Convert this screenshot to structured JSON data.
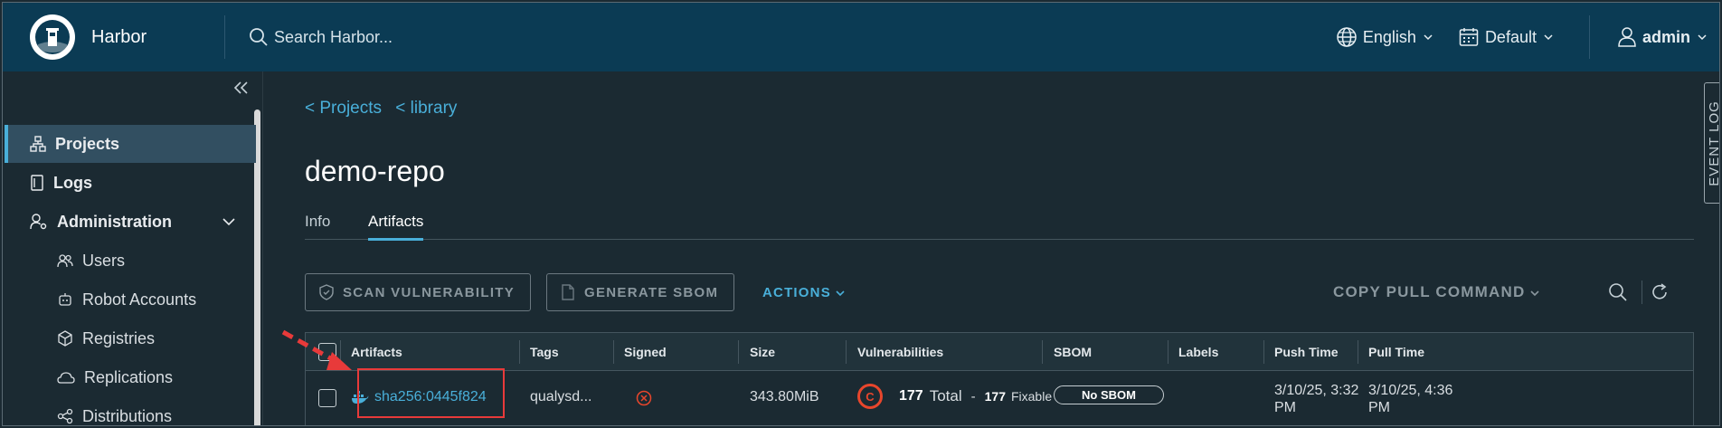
{
  "header": {
    "brand": "Harbor",
    "search_placeholder": "Search Harbor...",
    "language": "English",
    "theme": "Default",
    "user": "admin"
  },
  "sidebar": {
    "items": [
      {
        "label": "Projects",
        "icon": "projects-icon",
        "active": true
      },
      {
        "label": "Logs",
        "icon": "logs-icon"
      },
      {
        "label": "Administration",
        "icon": "administration-icon",
        "expandable": true
      },
      {
        "label": "Users",
        "icon": "users-icon"
      },
      {
        "label": "Robot Accounts",
        "icon": "robot-icon"
      },
      {
        "label": "Registries",
        "icon": "registries-icon"
      },
      {
        "label": "Replications",
        "icon": "replications-icon"
      },
      {
        "label": "Distributions",
        "icon": "distributions-icon"
      }
    ]
  },
  "breadcrumb": {
    "projects": "< Projects",
    "library": "< library"
  },
  "page": {
    "title": "demo-repo"
  },
  "tabs": [
    {
      "label": "Info",
      "active": false
    },
    {
      "label": "Artifacts",
      "active": true
    }
  ],
  "toolbar": {
    "scan": "SCAN VULNERABILITY",
    "sbom": "GENERATE SBOM",
    "actions": "ACTIONS",
    "copy_pull": "COPY PULL COMMAND"
  },
  "table": {
    "columns": [
      "Artifacts",
      "Tags",
      "Signed",
      "Size",
      "Vulnerabilities",
      "SBOM",
      "Labels",
      "Push Time",
      "Pull Time"
    ],
    "rows": [
      {
        "artifact": "sha256:0445f824",
        "tags": "qualysd...",
        "signed": false,
        "size": "343.80MiB",
        "severity": "C",
        "vuln_total": "177",
        "vuln_total_label": "Total",
        "vuln_dash": "-",
        "vuln_fixable": "177",
        "vuln_fixable_label": "Fixable",
        "sbom": "No SBOM",
        "labels": "",
        "push_time_1": "3/10/25, 3:32",
        "push_time_2": "PM",
        "pull_time_1": "3/10/25, 4:36",
        "pull_time_2": "PM"
      }
    ]
  },
  "event_log": "EVENT LOG",
  "colors": {
    "header_bg": "#0b3b54",
    "page_bg": "#1b2a32",
    "accent": "#49afd9",
    "highlight": "#e83a3a",
    "critical": "#e8462c"
  }
}
